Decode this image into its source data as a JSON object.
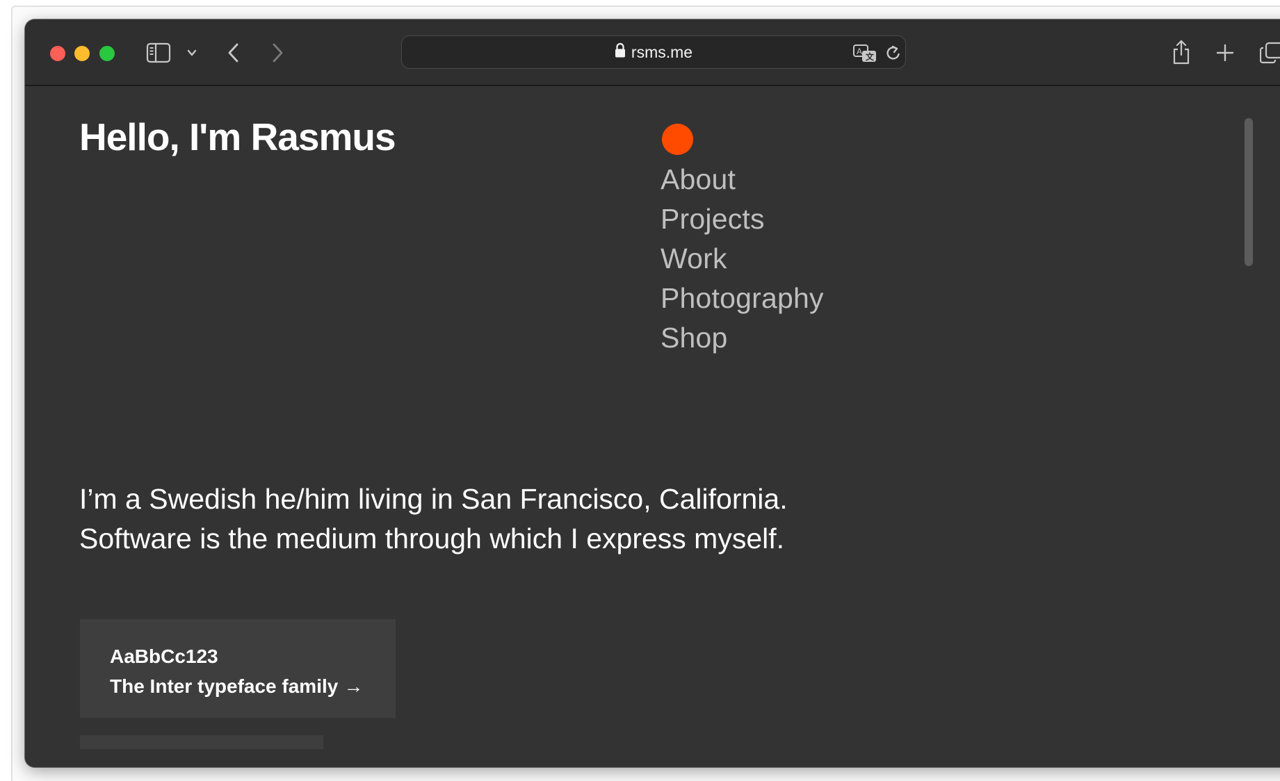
{
  "browser": {
    "url": "rsms.me",
    "icons": {
      "sidebar": "sidebar-icon",
      "sidebar_menu": "chevron-down-icon",
      "back": "chevron-left-icon",
      "forward": "chevron-right-icon",
      "secure": "lock-icon",
      "translate": "translate-icon",
      "reload": "reload-icon",
      "share": "share-icon",
      "new_tab": "plus-icon",
      "tab_overview": "tabs-icon"
    }
  },
  "page": {
    "title": "Hello, I'm Rasmus",
    "nav": [
      "About",
      "Projects",
      "Work",
      "Photography",
      "Shop"
    ],
    "intro": [
      "I’m a Swedish he/him living in San Francisco, California.",
      "Software is the medium through which I express myself."
    ],
    "card": {
      "sample": "AaBbCc123",
      "link": "The Inter typeface family",
      "arrow": "→"
    }
  },
  "colors": {
    "background": "#333333",
    "accent": "#ff4b00",
    "nav_text": "#bfbfbf",
    "text": "#ffffff",
    "card": "#3e3e3e"
  }
}
